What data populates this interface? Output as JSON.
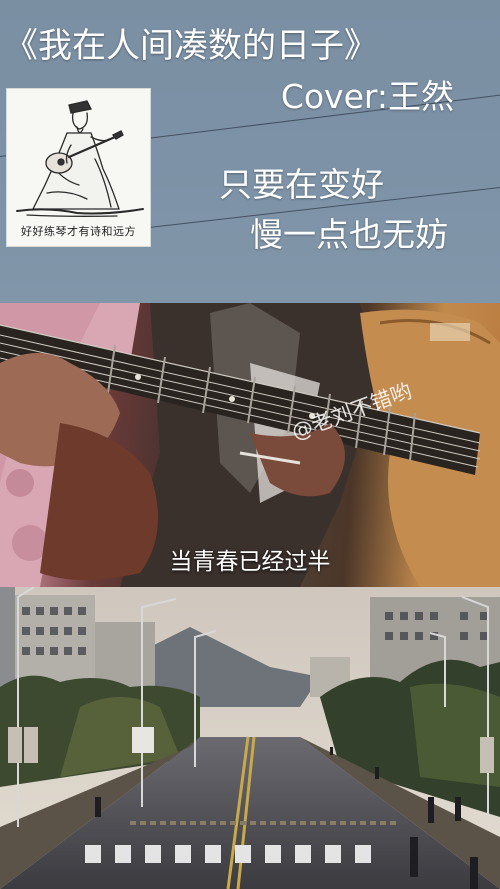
{
  "header": {
    "song_title": "《我在人间凑数的日子》",
    "cover_credit": "Cover:王然",
    "lyric_line_1": "只要在变好",
    "lyric_line_2": "慢一点也无妨"
  },
  "sketch_card": {
    "caption": "好好练琴才有诗和远方"
  },
  "video_frame": {
    "watermark": "@老刘不错哟",
    "subtitle": "当青春已经过半"
  },
  "colors": {
    "top_background": "#7d92a6",
    "text": "#ffffff",
    "guitar_body": "#c28a4d"
  }
}
